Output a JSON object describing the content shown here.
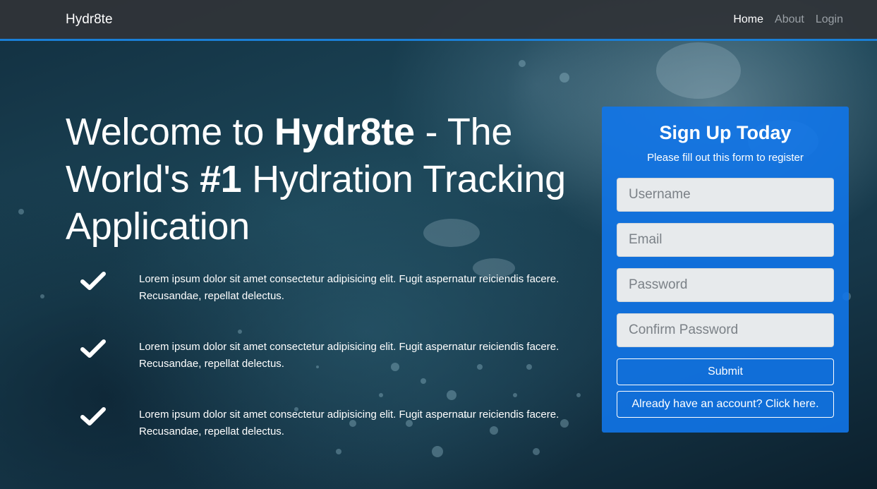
{
  "nav": {
    "brand": "Hydr8te",
    "links": [
      "Home",
      "About",
      "Login"
    ]
  },
  "hero": {
    "title_parts": [
      "Welcome to ",
      "Hydr8te",
      " - The World's ",
      "#1",
      " Hydration Tracking Application"
    ]
  },
  "features": [
    {
      "icon": "check-icon",
      "text": "Lorem ipsum dolor sit amet consectetur adipisicing elit. Fugit aspernatur reiciendis facere. Recusandae, repellat delectus."
    },
    {
      "icon": "check-icon",
      "text": "Lorem ipsum dolor sit amet consectetur adipisicing elit. Fugit aspernatur reiciendis facere. Recusandae, repellat delectus."
    },
    {
      "icon": "check-icon",
      "text": "Lorem ipsum dolor sit amet consectetur adipisicing elit. Fugit aspernatur reiciendis facere. Recusandae, repellat delectus."
    }
  ],
  "signup": {
    "title": "Sign Up Today",
    "subtitle": "Please fill out this form to register",
    "username_placeholder": "Username",
    "email_placeholder": "Email",
    "password_placeholder": "Password",
    "confirm_placeholder": "Confirm Password",
    "submit_label": "Submit",
    "login_label": "Already have an account? Click here."
  },
  "colors": {
    "accent": "#1a7fd6",
    "card": "#1176e9",
    "navbar": "#303438"
  }
}
